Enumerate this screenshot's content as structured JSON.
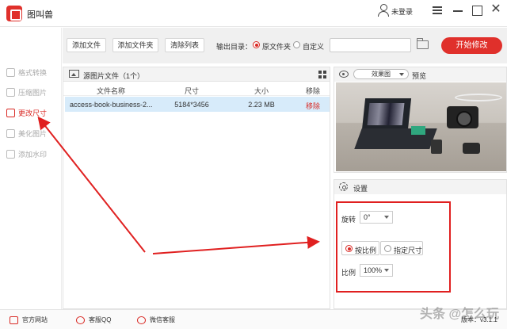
{
  "app": {
    "title": "图叫兽",
    "login": "未登录"
  },
  "sidebar": {
    "items": [
      {
        "label": "格式转换"
      },
      {
        "label": "压缩图片"
      },
      {
        "label": "更改尺寸"
      },
      {
        "label": "美化图片"
      },
      {
        "label": "添加水印"
      }
    ],
    "active_index": 2
  },
  "toolbar": {
    "add_file": "添加文件",
    "add_folder": "添加文件夹",
    "clear_list": "清除列表",
    "output_label": "输出目录：",
    "option_source": "原文件夹",
    "option_custom": "自定义",
    "path_value": "",
    "start": "开始修改"
  },
  "filelist": {
    "title": "源图片文件（1个）",
    "columns": [
      "文件名称",
      "尺寸",
      "大小",
      "移除"
    ],
    "rows": [
      {
        "name": "access-book-business-2...",
        "size": "5184*3456",
        "filesize": "2.23 MB",
        "remove": "移除"
      }
    ]
  },
  "preview": {
    "view_mode": "效果图",
    "label": "预览"
  },
  "settings": {
    "title": "设置",
    "rotate_label": "旋转",
    "rotate_value": "0°",
    "mode_ratio": "按比例",
    "mode_size": "指定尺寸",
    "ratio_label": "比例",
    "ratio_value": "100%"
  },
  "footer": {
    "website": "官方网站",
    "qq": "客服QQ",
    "wechat": "微信客服",
    "version": "版本：v3.1.1",
    "watermark": "头条 @怎么玩"
  },
  "colors": {
    "accent": "#e0302b",
    "selection": "#d7ebfa",
    "annotation": "#e02020"
  }
}
